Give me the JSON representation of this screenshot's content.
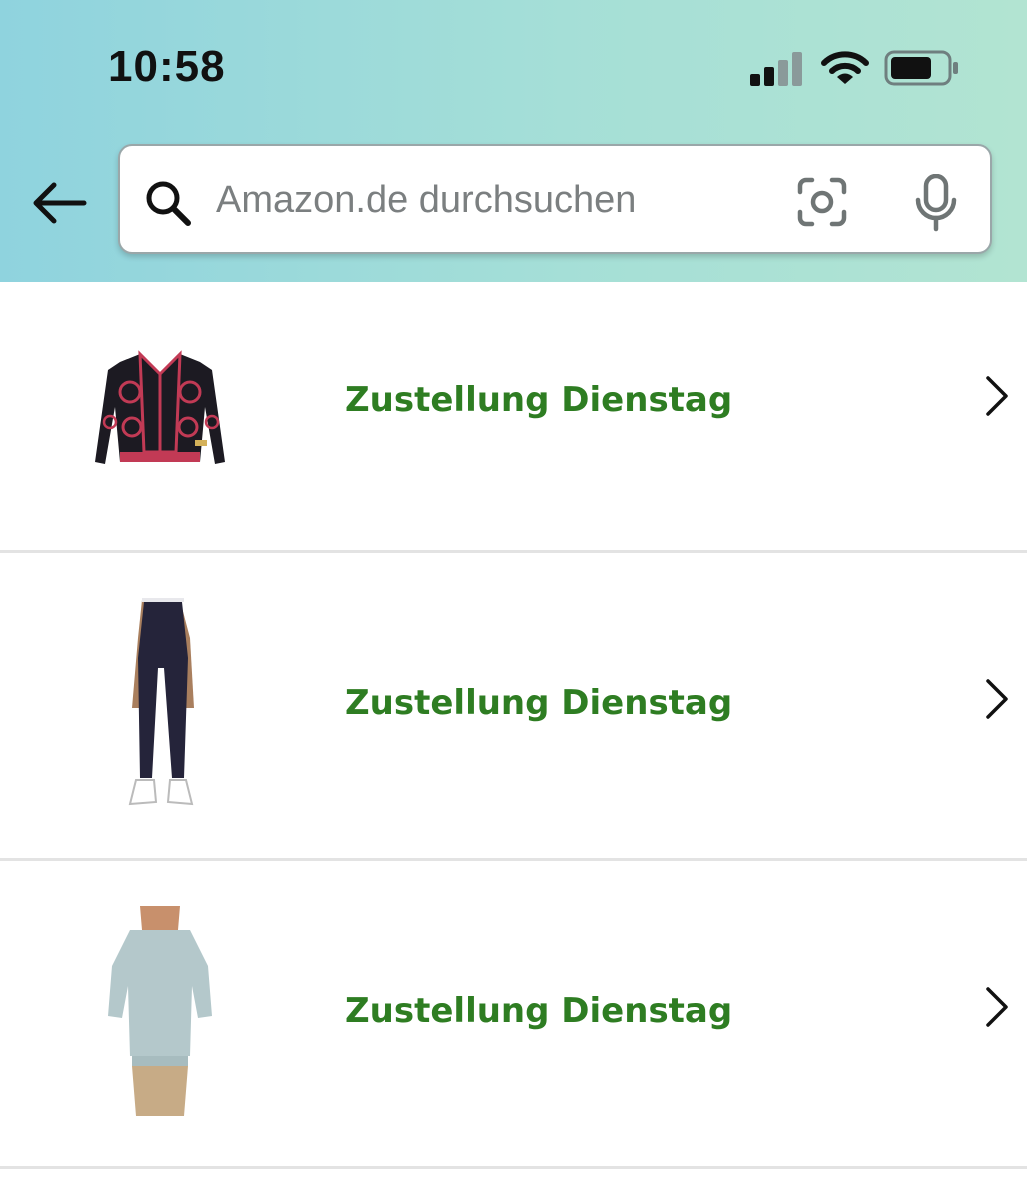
{
  "status_bar": {
    "time": "10:58"
  },
  "icons": {
    "back": "arrow-left-icon",
    "search": "search-icon",
    "camera": "camera-scan-icon",
    "mic": "microphone-icon",
    "signal": "cellular-signal-icon",
    "wifi": "wifi-icon",
    "battery": "battery-icon",
    "chevron": "chevron-right-icon"
  },
  "search": {
    "placeholder": "Amazon.de durchsuchen",
    "value": ""
  },
  "colors": {
    "delivery_text": "#2e7d22",
    "header_gradient_start": "#8fd3de",
    "header_gradient_end": "#b2e4d2"
  },
  "items": [
    {
      "delivery": "Zustellung Dienstag",
      "product": "cardigan"
    },
    {
      "delivery": "Zustellung Dienstag",
      "product": "jeans"
    },
    {
      "delivery": "Zustellung Dienstag",
      "product": "blouse"
    }
  ]
}
